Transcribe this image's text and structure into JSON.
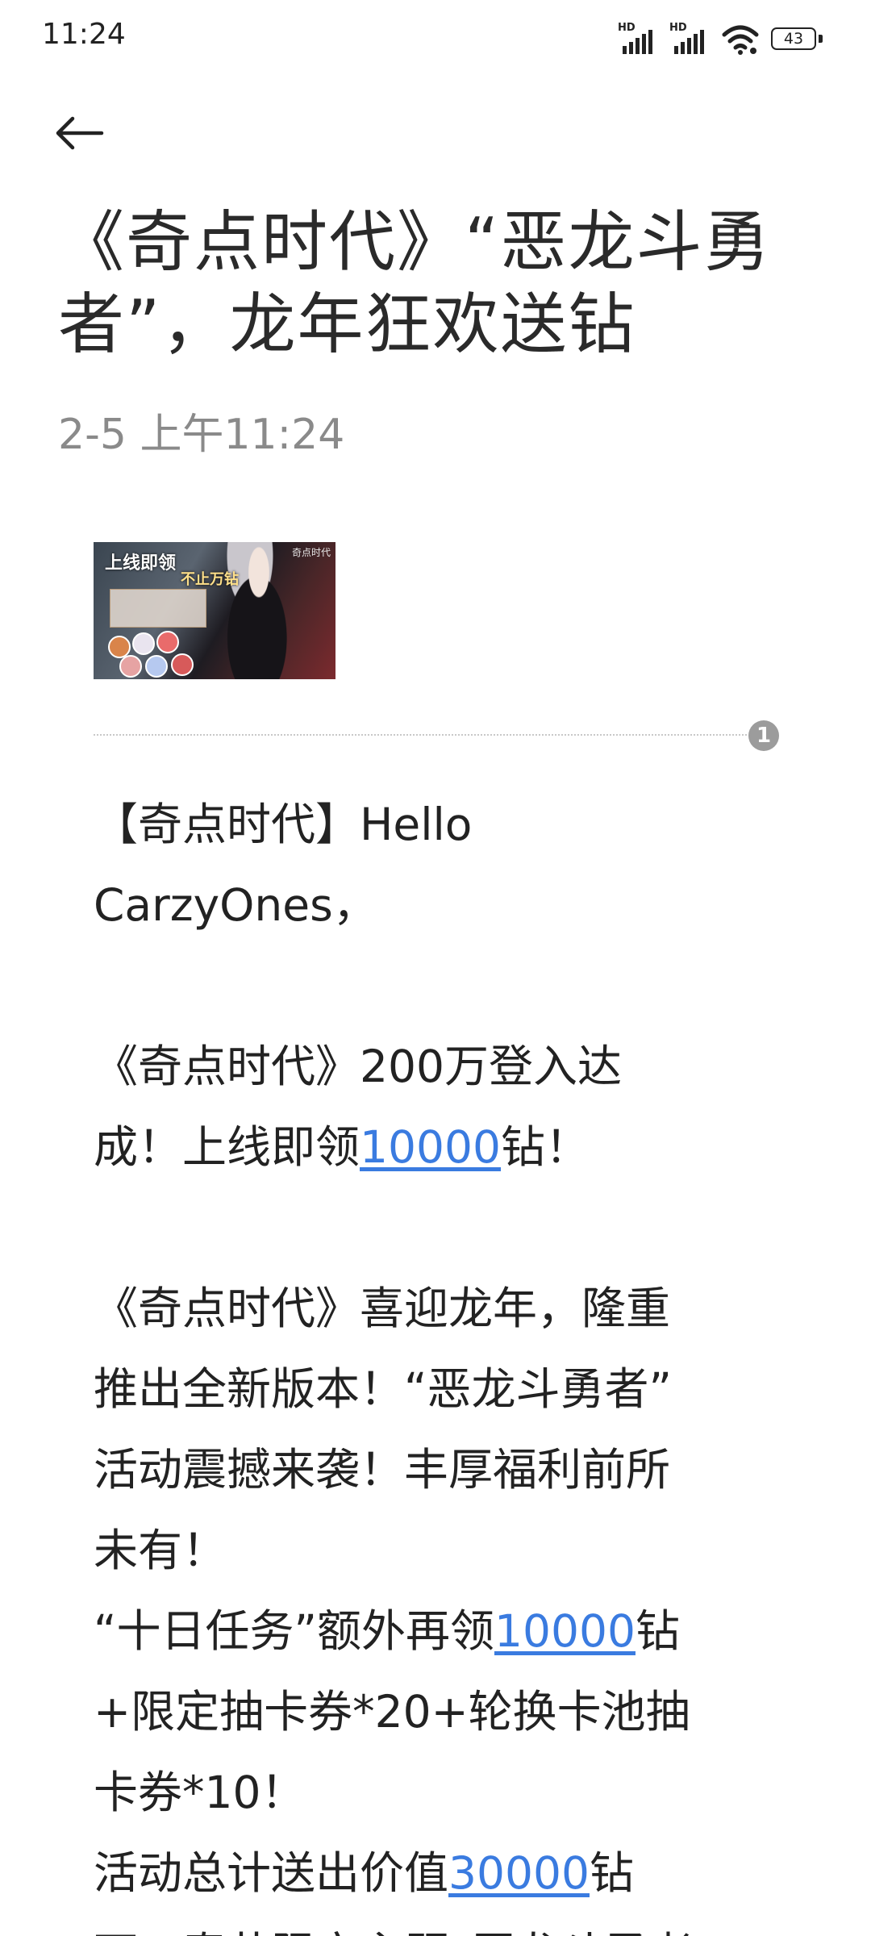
{
  "status_bar": {
    "time": "11:24",
    "signal1_label": "HD",
    "signal2_label": "HD",
    "battery_level": "43",
    "icons": [
      "signal-icon",
      "signal-icon",
      "wifi-icon",
      "battery-icon"
    ]
  },
  "header": {
    "back_icon": "back-arrow-icon"
  },
  "message": {
    "title": "《奇点时代》“恶龙斗勇者”，龙年狂欢送钻",
    "timestamp": "2-5 上午11:24",
    "image": {
      "headline": "上线即领",
      "subheadline": "不止万钻",
      "brand": "奇点时代"
    },
    "attachment_count": "1",
    "body": {
      "greeting_1": "【奇点时代】Hello",
      "greeting_2": "CarzyOnes，",
      "p1_line1": "《奇点时代》200万登入达",
      "p1_line2_a": "成！上线即领",
      "p1_line2_link": "10000",
      "p1_line2_b": "钻！",
      "p2_line1": "《奇点时代》喜迎龙年，隆重",
      "p2_line2": "推出全新版本！“恶龙斗勇者”",
      "p2_line3": "活动震撼来袭！丰厚福利前所",
      "p2_line4": "未有！",
      "p2_line5_a": "“十日任务”额外再领",
      "p2_line5_link": "10000",
      "p2_line5_b": "钻",
      "p2_line6": "+限定抽卡券*20+轮换卡池抽",
      "p2_line7": "卡券*10！",
      "p2_line8_a": "活动总计送出价值",
      "p2_line8_link": "30000",
      "p2_line8_b": "钻",
      "p2_line9": "下，春节限定主题“恶龙斗勇者”"
    }
  },
  "colors": {
    "link": "#3a7be0",
    "timestamp": "#8a8a8a",
    "badge": "#9c9c9c",
    "text": "#222222"
  }
}
